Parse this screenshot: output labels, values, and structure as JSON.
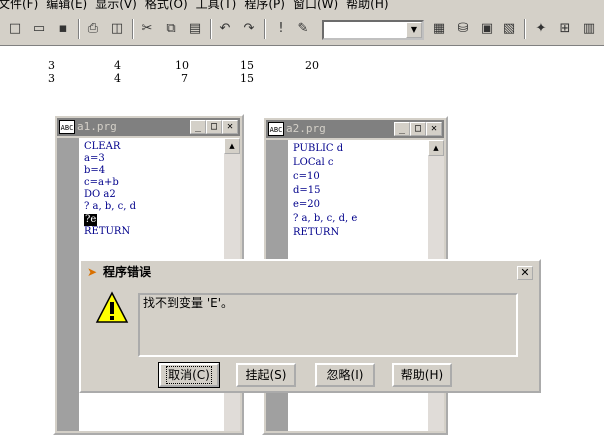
{
  "menubar": {
    "items": [
      "文件(F)",
      "编辑(E)",
      "显示(V)",
      "格式(O)",
      "工具(T)",
      "程序(P)",
      "窗口(W)",
      "帮助(H)"
    ]
  },
  "toolbar": {
    "combo_value": ""
  },
  "output": {
    "rows": [
      [
        "3",
        "4",
        "10",
        "15",
        "20"
      ],
      [
        "3",
        "4",
        "7",
        "15"
      ]
    ]
  },
  "window_a1": {
    "title": "a1.prg",
    "lines": [
      "CLEAR",
      "a=3",
      "b=4",
      "c=a+b",
      "DO a2",
      "? a, b, c, d",
      "?e",
      "RETURN"
    ],
    "selected_line": "?e"
  },
  "window_a2": {
    "title": "a2.prg",
    "lines": [
      "PUBLIC d",
      "LOCal c",
      "c=10",
      "d=15",
      "e=20",
      "? a, b, c, d, e",
      "",
      "RETURN"
    ]
  },
  "dialog": {
    "title": "程序错误",
    "message": "找不到变量 'E'。",
    "buttons": {
      "cancel": "取消(C)",
      "suspend": "挂起(S)",
      "ignore": "忽略(I)",
      "help": "帮助(H)"
    }
  }
}
